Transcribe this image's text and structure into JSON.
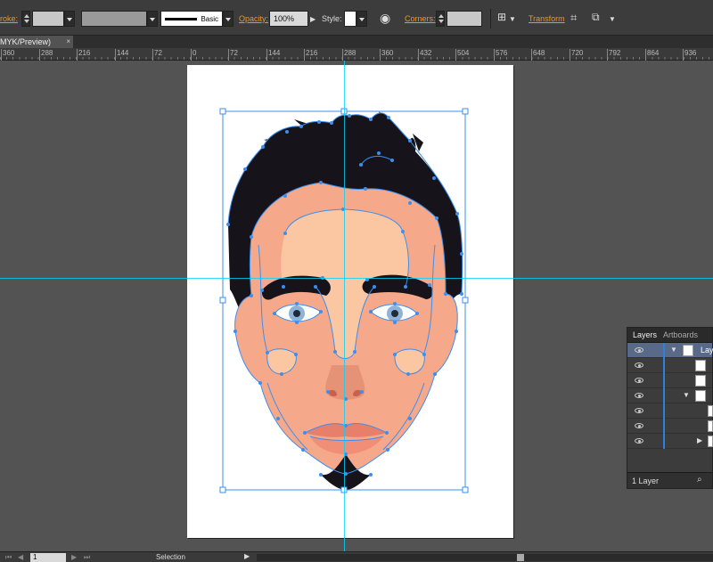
{
  "control_bar": {
    "stroke_label": "roke:",
    "brush_preset": "Basic",
    "opacity_label": "Opacity:",
    "opacity_value": "100%",
    "style_label": "Style:",
    "corners_label": "Corners:",
    "transform_label": "Transform"
  },
  "document_tab": {
    "title": "MYK/Preview)",
    "close": "×"
  },
  "ruler": {
    "ticks": [
      "360",
      "288",
      "216",
      "144",
      "72",
      "0",
      "72",
      "144",
      "216",
      "288",
      "360",
      "432",
      "504",
      "576",
      "648",
      "720",
      "792",
      "864",
      "936"
    ]
  },
  "layers_panel": {
    "tabs": [
      "Layers",
      "Artboards"
    ],
    "top_layer_label": "Layer",
    "footer_label": "1 Layer"
  },
  "status_bar": {
    "page_value": "1",
    "tool_mode": "Selection"
  },
  "colors": {
    "accent_orange": "#f7941d",
    "guide_cyan": "#00d4ff",
    "path_blue": "#3b8ff0",
    "hair": "#16141a",
    "skin_shadow": "#f5a98a",
    "skin_light": "#fbc7a2",
    "lips": "#e77f6a"
  }
}
